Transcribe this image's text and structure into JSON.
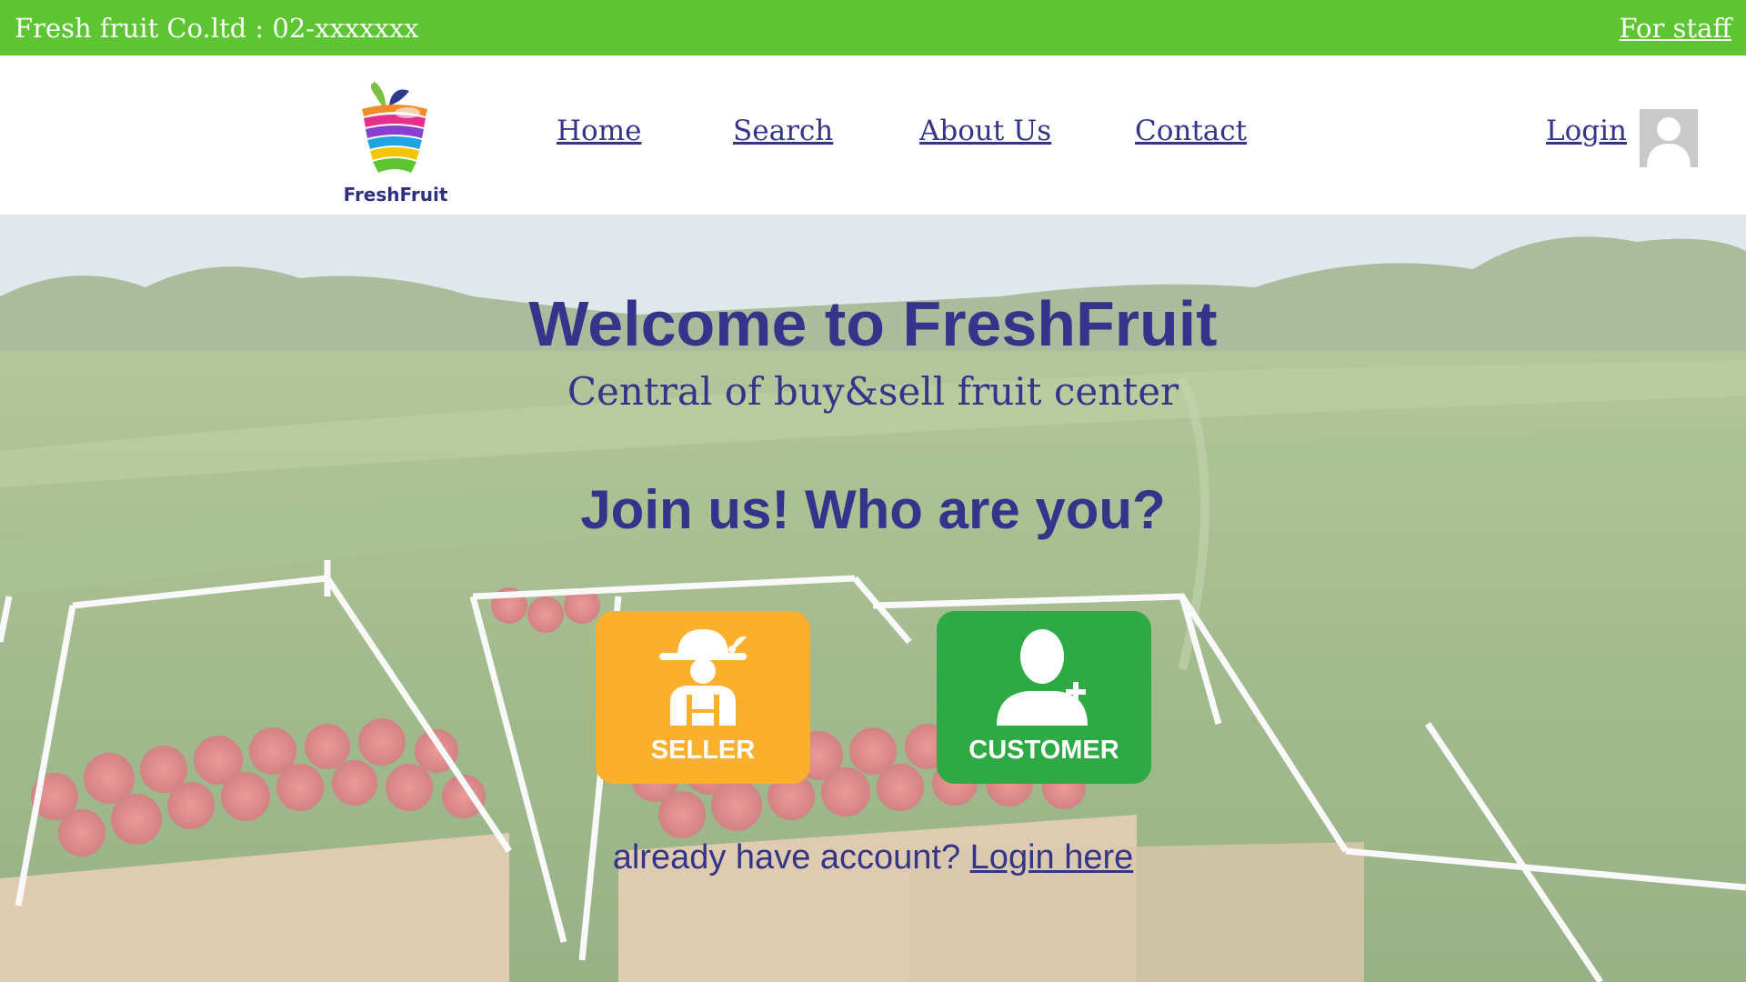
{
  "topbar": {
    "company_info": "Fresh fruit Co.ltd : 02-xxxxxxx",
    "staff_link": "For staff"
  },
  "logo": {
    "text": "FreshFruit"
  },
  "nav": {
    "home": "Home",
    "search": "Search",
    "about": "About Us",
    "contact": "Contact",
    "login": "Login"
  },
  "hero": {
    "title": "Welcome to FreshFruit",
    "subtitle": "Central of buy&sell fruit center",
    "join_prompt": "Join us! Who are you?",
    "seller_label": "SELLER",
    "customer_label": "CUSTOMER",
    "login_prompt": "already have account?",
    "login_link": "Login here"
  },
  "colors": {
    "topbar_bg": "#5dc532",
    "primary_text": "#34348a",
    "seller_bg": "#fbb02d",
    "customer_bg": "#2eaa44"
  },
  "icons": {
    "seller": "farmer-icon",
    "customer": "add-user-icon",
    "avatar": "user-avatar-icon"
  }
}
